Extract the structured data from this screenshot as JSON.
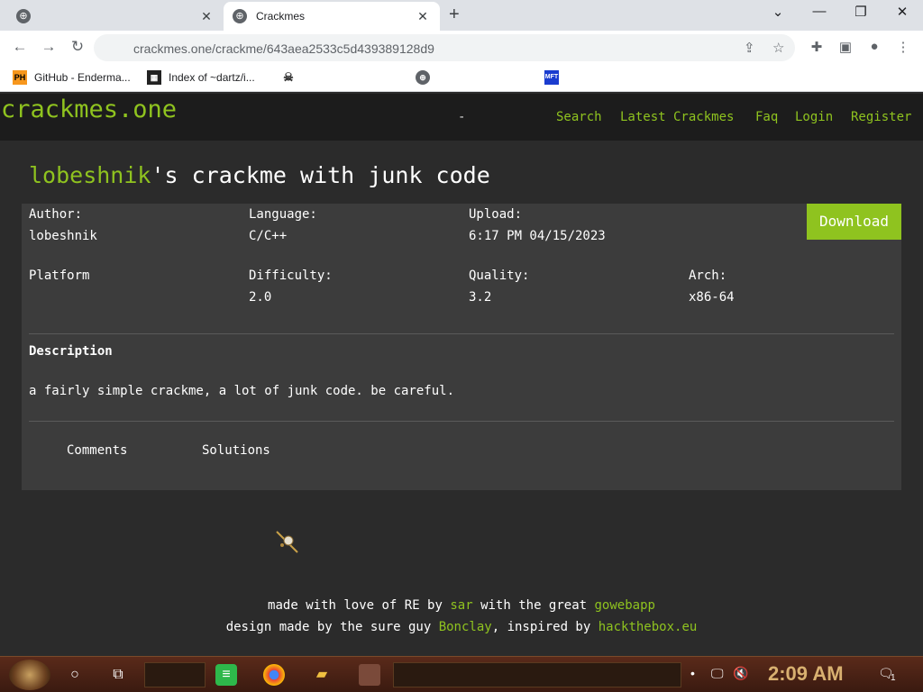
{
  "browser": {
    "tabs": [
      {
        "title": ""
      },
      {
        "title": "Crackmes"
      }
    ],
    "url": "crackmes.one/crackme/643aea2533c5d439389128d9",
    "bookmarks": [
      {
        "label": "GitHub - Enderma...",
        "icon": "PH"
      },
      {
        "label": "Index of ~dartz/i...",
        "icon": "grid"
      },
      {
        "label": "",
        "icon": "skull"
      },
      {
        "label": "",
        "icon": "globe"
      },
      {
        "label": "",
        "icon": "MFT"
      }
    ]
  },
  "site": {
    "logo": "crackmes.one",
    "dash": "-",
    "nav": [
      "Search",
      "Latest Crackmes",
      "Faq",
      "Login",
      "Register"
    ]
  },
  "crackme": {
    "author_name": "lobeshnik",
    "title_rest": "'s crackme with junk code",
    "download_label": "Download",
    "fields": {
      "author": {
        "label": "Author:",
        "value": "lobeshnik"
      },
      "language": {
        "label": "Language:",
        "value": "C/C++"
      },
      "upload": {
        "label": "Upload:",
        "value": "6:17 PM 04/15/2023"
      },
      "platform": {
        "label": "Platform",
        "value": ""
      },
      "difficulty": {
        "label": "Difficulty:",
        "value": "2.0"
      },
      "quality": {
        "label": "Quality:",
        "value": "3.2"
      },
      "arch": {
        "label": "Arch:",
        "value": "x86-64"
      }
    },
    "description_heading": "Description",
    "description": "a fairly simple crackme, a lot of junk code. be careful.",
    "tabs": [
      "Comments",
      "Solutions"
    ]
  },
  "footer": {
    "line1_a": "made with love of RE by ",
    "line1_sar": "sar",
    "line1_b": " with the great ",
    "line1_gowebapp": "gowebapp",
    "line2_a": "design made by the sure guy ",
    "line2_bonclay": "Bonclay",
    "line2_b": ", inspired by ",
    "line2_htb": "hackthebox.eu"
  },
  "taskbar": {
    "clock": "2:09 AM",
    "notification_count": "1"
  },
  "colors": {
    "accent_green": "#8fc31f",
    "page_bg": "#2b2b2b",
    "card_bg": "#3c3c3c",
    "header_bg": "#1c1c1c"
  }
}
